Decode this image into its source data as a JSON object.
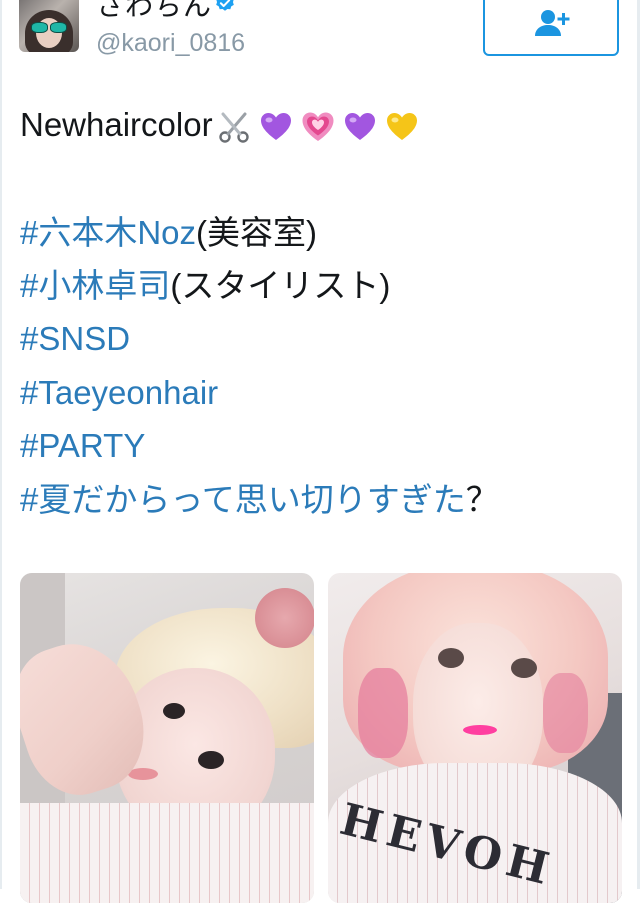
{
  "user": {
    "display_name": "さわちん",
    "handle": "@kaori_0816"
  },
  "icons": {
    "avatar": "profile-photo",
    "verified": "verified-badge-icon",
    "follow": "add-user-icon"
  },
  "colors": {
    "hashtag": "#2b7bb9",
    "accent": "#1b95e0",
    "text": "#14171a",
    "muted": "#8899a6"
  },
  "tweet": {
    "text_line1": "Newhaircolor",
    "emojis": [
      "scissors",
      "purple-heart",
      "growing-heart",
      "purple-heart",
      "yellow-heart"
    ],
    "hashtags": {
      "h1": "#六本木Noz",
      "h1_suffix": "(美容室)",
      "h2": "#小林卓司",
      "h2_suffix": "(スタイリスト)",
      "h3": "#SNSD",
      "h4": "#Taeyeonhair",
      "h5": "#PARTY",
      "h6": "#夏だからって思い切りすぎた",
      "h6_suffix": "？"
    }
  },
  "media": {
    "photo_count": 2,
    "shirt_text": "HEVOH"
  }
}
